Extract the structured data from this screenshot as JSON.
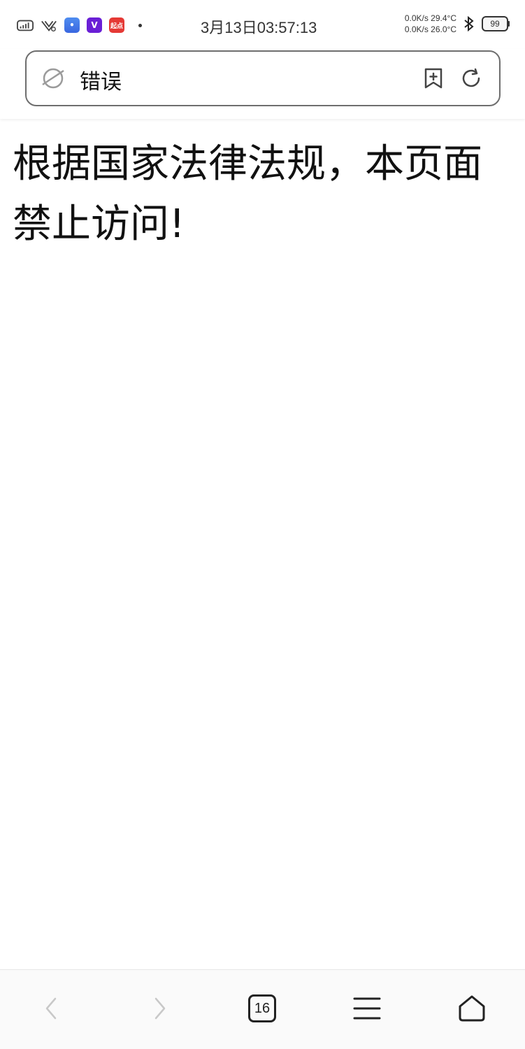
{
  "status_bar": {
    "time": "3月13日03:57:13",
    "net_upload": "0.0K/s 29.4°C",
    "net_download": "0.0K/s 26.0°C",
    "battery": "99",
    "apps": {
      "tile_v": "V",
      "tile_red": "起点"
    }
  },
  "address_bar": {
    "title": "错误"
  },
  "content": {
    "message": "根据国家法律法规，本页面禁止访问!"
  },
  "bottom_toolbar": {
    "tabs_count": "16"
  }
}
